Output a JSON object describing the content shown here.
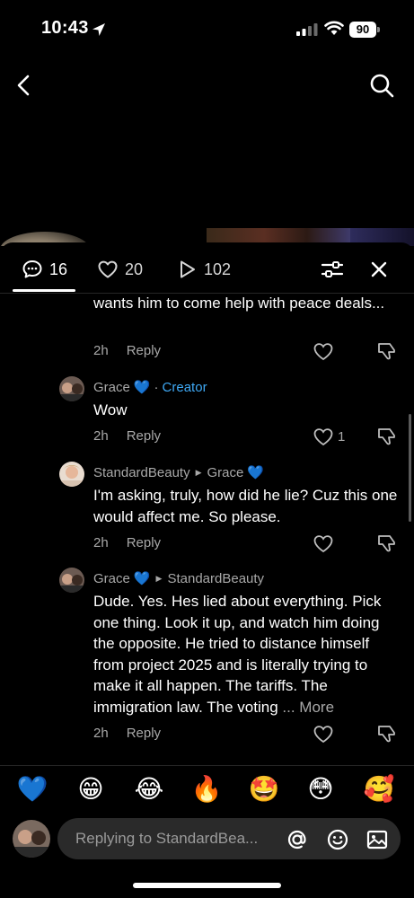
{
  "status": {
    "time": "10:43",
    "battery": "90"
  },
  "tabs": {
    "comments_count": "16",
    "likes_count": "20",
    "plays_count": "102"
  },
  "comments": [
    {
      "text": "wants him to come help with peace deals...",
      "time": "2h",
      "reply_label": "Reply"
    },
    {
      "author": "Grace",
      "heart": "💙",
      "creator_label": "Creator",
      "text": "Wow",
      "time": "2h",
      "reply_label": "Reply",
      "likes": "1"
    },
    {
      "author": "StandardBeauty",
      "reply_to": "Grace",
      "heart": "💙",
      "text": "I'm asking, truly, how did he lie? Cuz this one would affect me. So please.",
      "time": "2h",
      "reply_label": "Reply"
    },
    {
      "author": "Grace",
      "heart": "💙",
      "reply_to": "StandardBeauty",
      "text": "Dude. Yes. Hes lied about everything. Pick one thing. Look it up, and watch him doing the opposite. He tried to distance himself from project 2025 and is literally trying to make it all happen. The tariffs. The immigration law. The voting",
      "more_label": "... More",
      "time": "2h",
      "reply_label": "Reply"
    }
  ],
  "emoji_bar": [
    "💙",
    "😁",
    "😂",
    "🔥",
    "🤩",
    "😳",
    "🥰"
  ],
  "input": {
    "placeholder": "Replying to StandardBea..."
  }
}
